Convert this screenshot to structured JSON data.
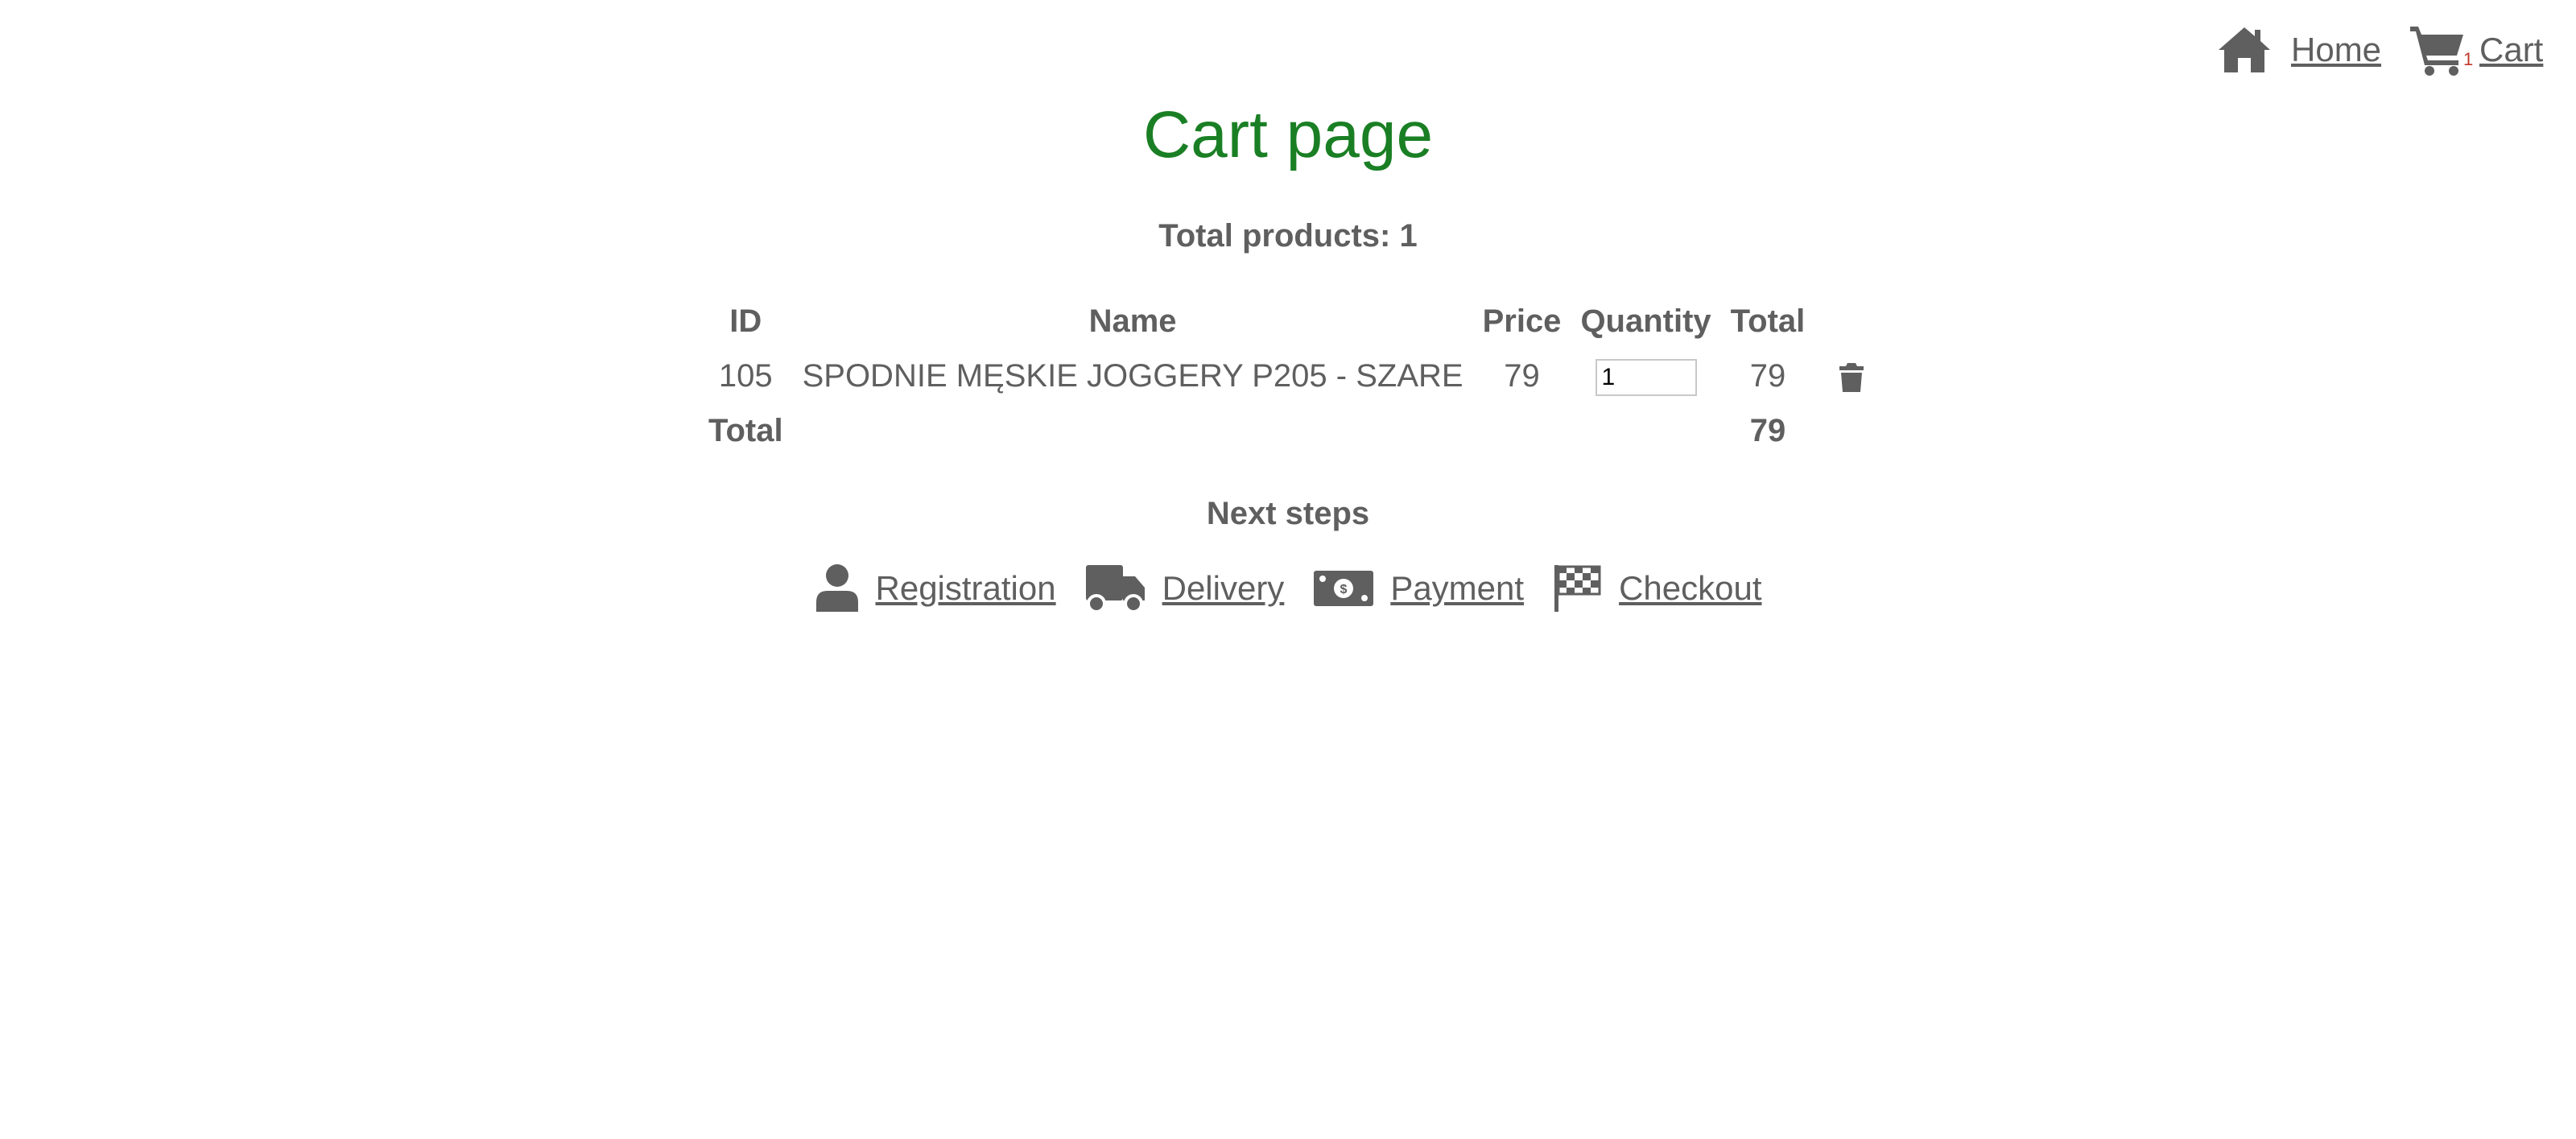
{
  "nav": {
    "home_label": "Home",
    "cart_label": "Cart",
    "cart_count": "1"
  },
  "page": {
    "title": "Cart page",
    "total_products": "Total products: 1"
  },
  "table": {
    "headers": {
      "id": "ID",
      "name": "Name",
      "price": "Price",
      "quantity": "Quantity",
      "total": "Total"
    },
    "rows": [
      {
        "id": "105",
        "name": "SPODNIE MĘSKIE JOGGERY P205 - SZARE",
        "price": "79",
        "quantity": "1",
        "total": "79"
      }
    ],
    "footer": {
      "label": "Total",
      "total": "79"
    }
  },
  "next_steps": {
    "title": "Next steps",
    "registration_label": "Registration",
    "delivery_label": "Delivery",
    "payment_label": "Payment",
    "checkout_label": "Checkout"
  },
  "icons": {
    "home": "home-icon",
    "cart": "cart-icon",
    "trash": "trash-icon",
    "registration": "user-icon",
    "delivery": "truck-icon",
    "payment": "money-bill-icon",
    "checkout": "checkered-flag-icon"
  },
  "colors": {
    "title": "#1a7f24",
    "text": "#5f5f5f",
    "badge": "#c0392b"
  }
}
